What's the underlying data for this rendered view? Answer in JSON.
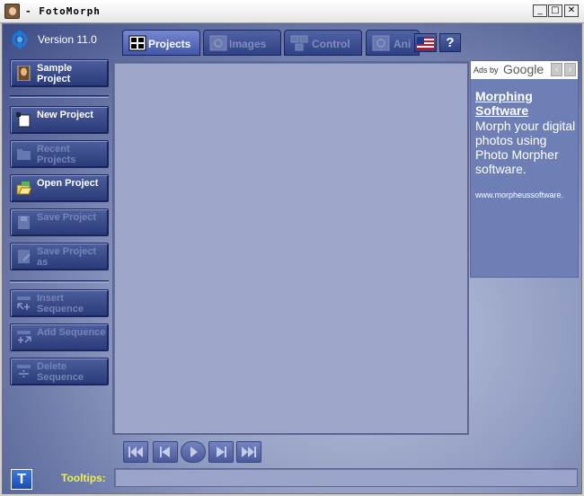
{
  "window": {
    "title": "- FotoMorph",
    "minimize_glyph": "_",
    "maximize_glyph": "□",
    "close_glyph": "✕"
  },
  "app": {
    "version": "Version 11.0"
  },
  "sidebar": {
    "sample": "Sample Project",
    "new": "New Project",
    "recent": "Recent Projects",
    "open": "Open Project",
    "save": "Save Project",
    "save_as": "Save Project as",
    "insert": "Insert Sequence",
    "add": "Add Sequence",
    "delete": "Delete Sequence"
  },
  "tabs": {
    "projects": "Projects",
    "images": "Images",
    "control": "Control",
    "animation": "Ani"
  },
  "help_label": "?",
  "ad": {
    "ads_by": "Ads by",
    "google": "Google",
    "title": "Morphing Software",
    "body": "Morph your digital photos using Photo Morpher software.",
    "url": "www.morpheussoftware."
  },
  "bottom": {
    "tooltips_toggle": "T",
    "tooltips_label": "Tooltips:",
    "tooltips_value": ""
  },
  "colors": {
    "accent": "#2f4185",
    "tooltips_label": "#e7ef5a"
  }
}
